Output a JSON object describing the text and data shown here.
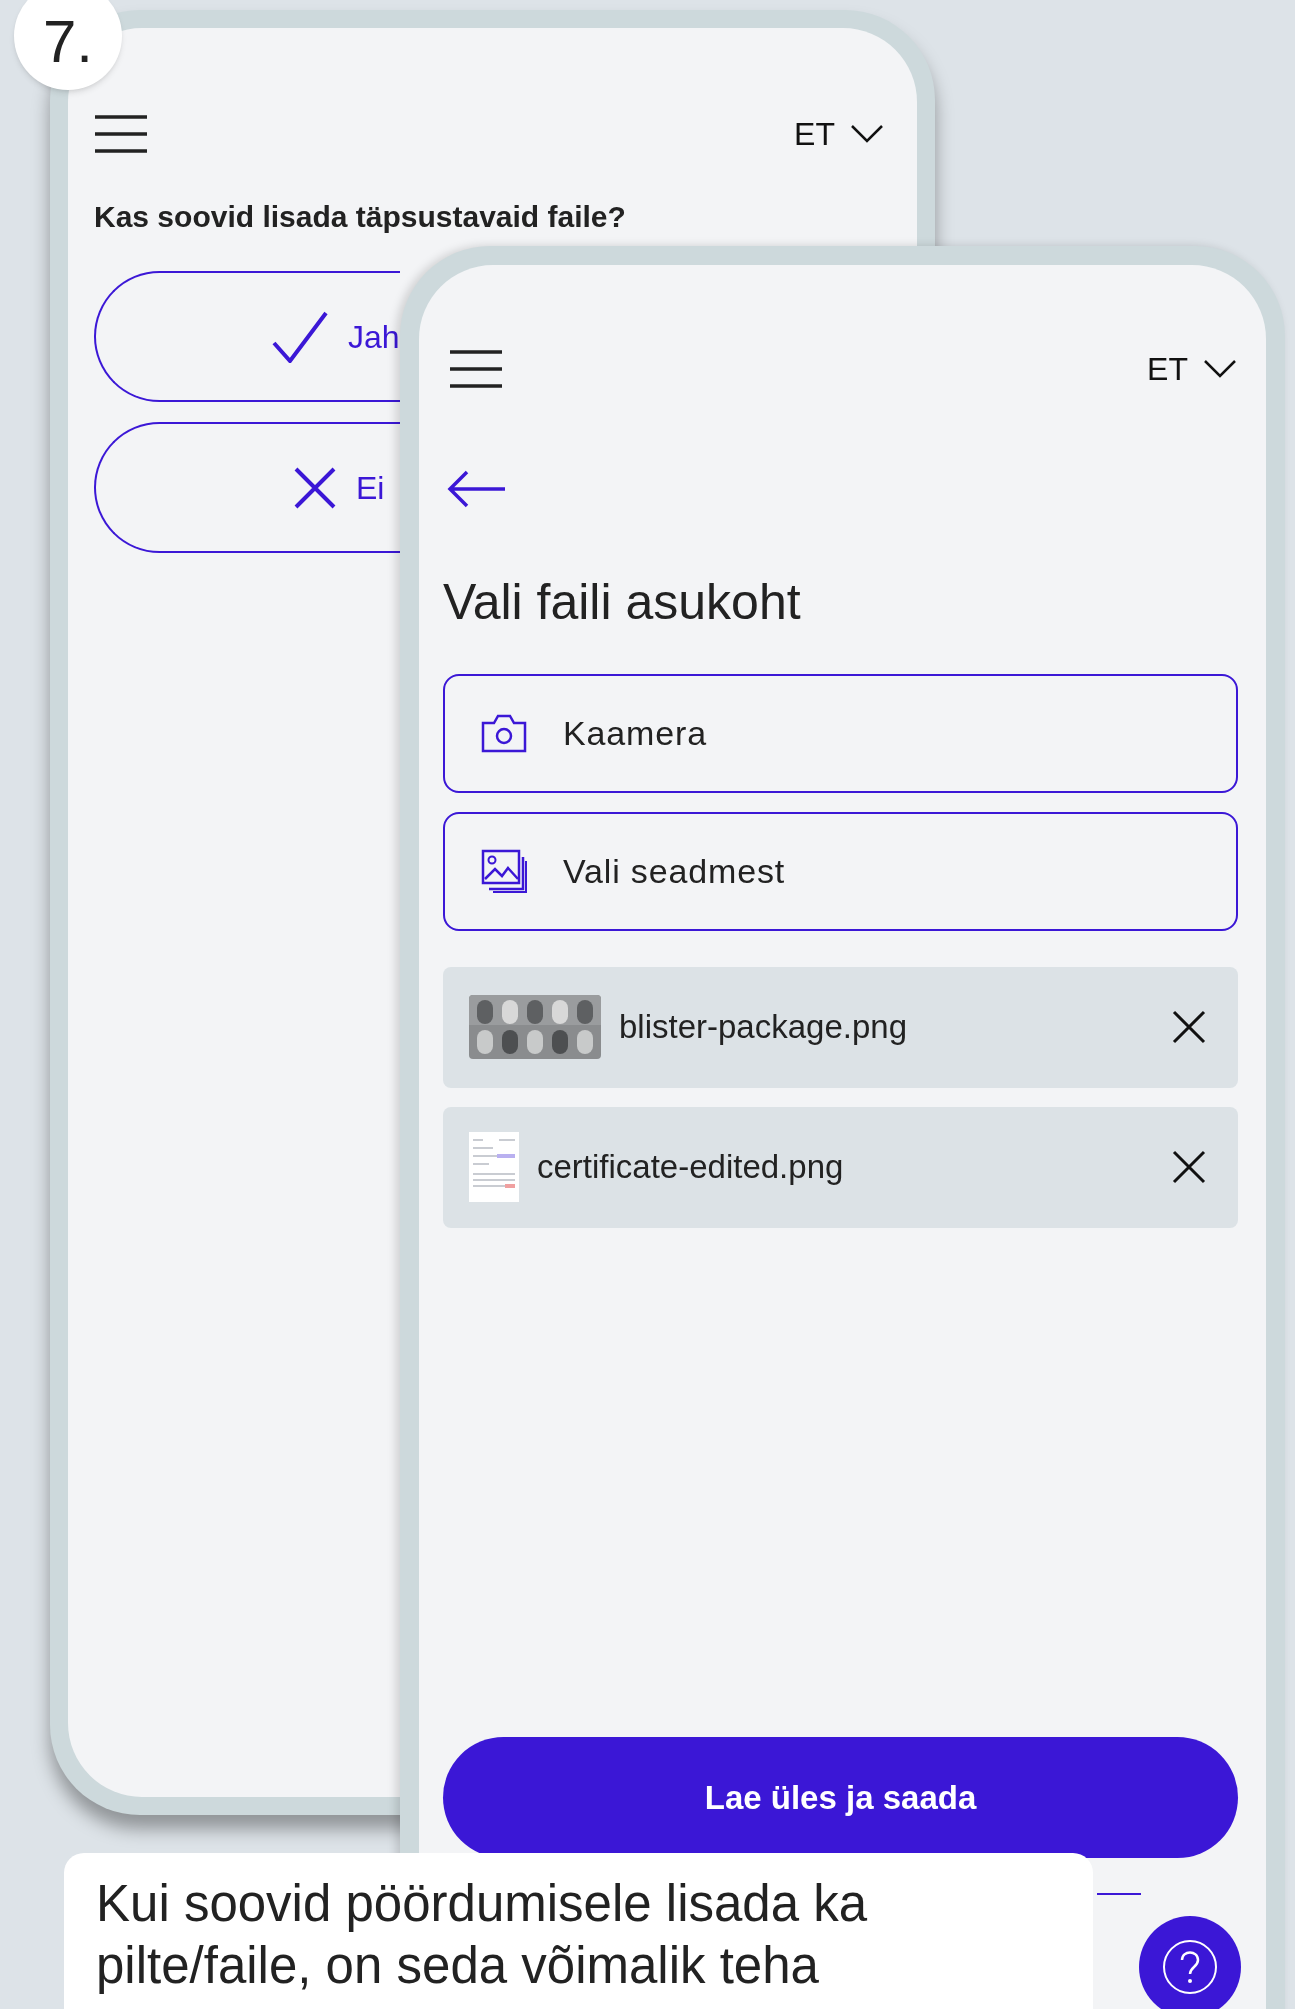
{
  "step_badge": "7.",
  "back_screen": {
    "language": "ET",
    "question": "Kas soovid lisada täpsustavaid faile?",
    "options": [
      {
        "kind": "check",
        "label": "Jah"
      },
      {
        "kind": "cross",
        "label": "Ei"
      }
    ]
  },
  "front_screen": {
    "language": "ET",
    "title": "Vali faili asukoht",
    "sources": [
      {
        "kind": "camera",
        "label": "Kaamera"
      },
      {
        "kind": "gallery",
        "label": "Vali seadmest"
      }
    ],
    "files": [
      {
        "kind": "picture",
        "name": "blister-package.png"
      },
      {
        "kind": "document",
        "name": "certificate-edited.png"
      }
    ],
    "submit": "Lae üles ja saada"
  },
  "caption": "Kui soovid pöördumisele lisada ka pilte/faile, on seda võimalik teha"
}
